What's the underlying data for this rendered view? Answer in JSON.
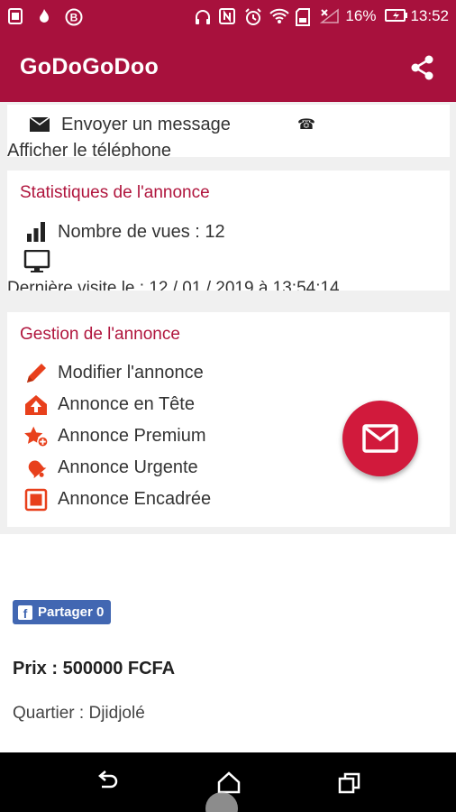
{
  "status_bar": {
    "battery": "16%",
    "time": "13:52",
    "icons": [
      "sim-icon",
      "fire-icon",
      "b-icon",
      "headphones-icon",
      "nfc-icon",
      "alarm-icon",
      "wifi-icon",
      "sd-card-icon",
      "signal-icon",
      "battery-icon"
    ]
  },
  "app_bar": {
    "title": "GoDoGoDoo",
    "share_icon": "share-icon"
  },
  "contact": {
    "send_message": "Envoyer un message",
    "show_phone": "Afficher le téléphone",
    "tel_glyph": "☎"
  },
  "stats": {
    "title": "Statistiques de l'annonce",
    "views": "Nombre de vues : 12",
    "last_visit": "Dernière visite le : 12 / 01 / 2019 à 13:54:14"
  },
  "management": {
    "title": "Gestion de l'annonce",
    "items": [
      {
        "label": "Modifier l'annonce",
        "icon": "pencil-icon"
      },
      {
        "label": "Annonce en Tête",
        "icon": "home-up-icon"
      },
      {
        "label": "Annonce Premium",
        "icon": "star-plus-icon"
      },
      {
        "label": "Annonce Urgente",
        "icon": "bell-icon"
      },
      {
        "label": "Annonce Encadrée",
        "icon": "frame-icon"
      }
    ]
  },
  "facebook": {
    "share_label": "Partager 0"
  },
  "listing": {
    "price": "Prix : 500000 FCFA",
    "quartier": "Quartier : Djidjolé"
  },
  "colors": {
    "brand": "#a8113d",
    "accent": "#d11a3c",
    "icon_orange": "#e8401c",
    "facebook": "#4267b2"
  }
}
